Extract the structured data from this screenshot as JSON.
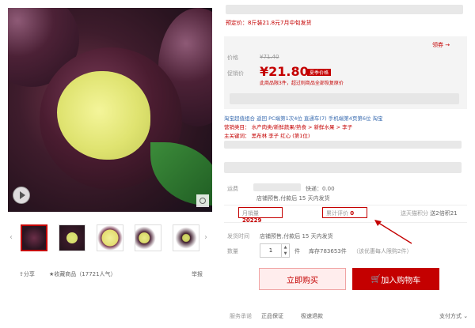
{
  "presale": "预定价：8斤装21.8元7月中旬发货",
  "coupon": "领券 →",
  "price_label": "价格",
  "original_price": "¥71.40",
  "promo_label": "促销价",
  "promo_price": "¥21.80",
  "promo_tag": "夏季价格",
  "promo_note": "此商品限3件，超过则商品全部恢复原价",
  "marketing_line": "淘宝超值组合 返回  PC端第1次4位  直通车(7)  手机端第4页第6位  淘宝",
  "category_line": "营销类目：  水产肉类/新鲜蔬果/熟食 > 新鲜水果 > 李子",
  "keyword_line": "主关键词：  黑布林  李子  红心  (第1位)",
  "shipping_label": "运费",
  "shipping_value": "快递：0.00",
  "shipping_note": "店铺预售,付款后 15 天内发货",
  "sales_label": "月销量",
  "sales_value": "20229",
  "reviews_label": "累计评价",
  "reviews_value": "0",
  "points_label": "送天猫积分",
  "points_value": "送2倍积21",
  "ship_time_label": "发货时间",
  "ship_time_value": "店铺预售,付款后 15 天内发货",
  "qty_label": "数量",
  "qty_value": "1",
  "qty_unit": "件",
  "stock": "库存783653件",
  "limit": "（该优惠每人限购2件）",
  "buy_now": "立即购买",
  "add_cart": "加入购物车",
  "share": "分享",
  "favorite": "收藏商品",
  "popularity": "（17721人气）",
  "report": "举报",
  "service_label": "服务承诺",
  "service_1": "正品保证",
  "service_2": "极速退款",
  "payment": "支付方式",
  "colors": {
    "brand_red": "#c40000",
    "link_blue": "#3a6cb0"
  }
}
